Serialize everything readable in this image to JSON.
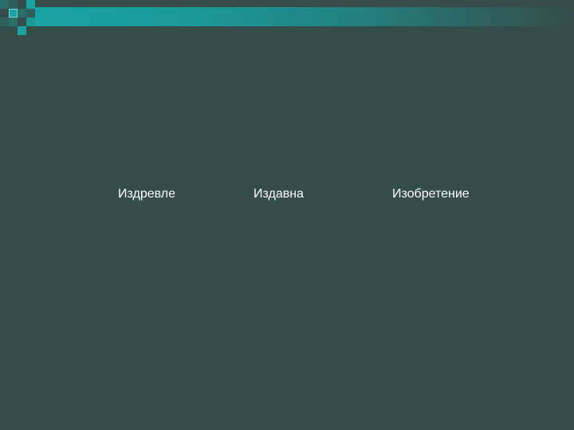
{
  "slide": {
    "words": [
      {
        "label": "Издревле"
      },
      {
        "label": "Издавна"
      },
      {
        "label": "Изобретение"
      }
    ]
  },
  "colors": {
    "background": "#354d49",
    "accent": "#1aa3a3",
    "text": "#ffffff"
  }
}
